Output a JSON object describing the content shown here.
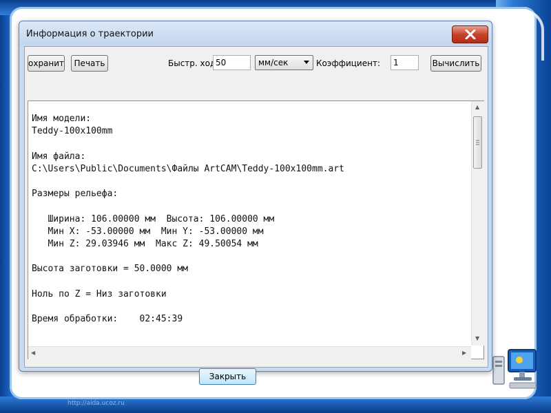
{
  "window": {
    "title": "Информация о траектории"
  },
  "toolbar": {
    "save_label": "охранит",
    "print_label": "Печать",
    "rapid_label": "Быстр. ход",
    "rapid_value": "50",
    "units_value": "мм/сек",
    "coef_label": "Коэффициент:",
    "coef_value": "1",
    "calc_label": "Вычислить"
  },
  "report": {
    "model_name_label": "Имя модели:",
    "model_name": "Teddy-100x100mm",
    "file_name_label": "Имя файла:",
    "file_path": "C:\\Users\\Public\\Documents\\Файлы ArtCAM\\Teddy-100x100mm.art",
    "relief_label": "Размеры рельефа:",
    "width_line": "   Ширина: 106.00000 мм  Высота: 106.00000 мм",
    "minxy_line": "   Мин X: -53.00000 мм  Мин Y: -53.00000 мм",
    "minmaxz_line": "   Мин Z: 29.03946 мм  Макс Z: 49.50054 мм",
    "blank_height": "Высота заготовки = 50.0000 мм",
    "zero_z": "Ноль по Z = Низ заготовки",
    "machining_time": "Время обработки:    02:45:39"
  },
  "footer": {
    "close_label": "Закрыть"
  },
  "watermark": "http://aida.ucoz.ru",
  "colors": {
    "close_button": "#c7442b",
    "title_bar": "#c2d6ee",
    "slide_blue": "#1f6fd1"
  },
  "icons": {
    "close": "close-x-icon",
    "dropdown": "chevron-down-icon",
    "computer": "computer-icon"
  }
}
